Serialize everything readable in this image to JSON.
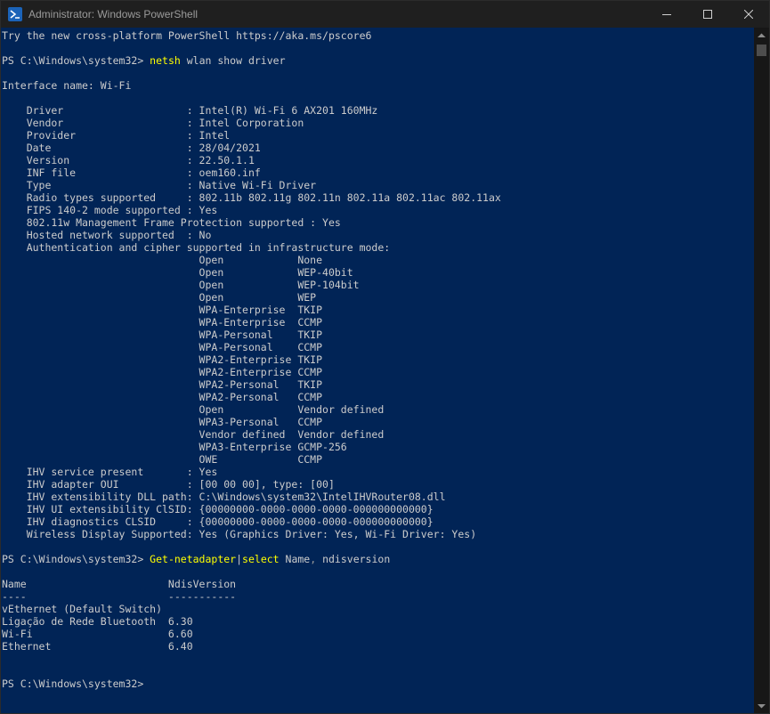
{
  "window": {
    "title": "Administrator: Windows PowerShell"
  },
  "console": {
    "lines": [
      {
        "text": "Try the new cross-platform PowerShell https://aka.ms/pscore6"
      },
      {
        "text": ""
      },
      {
        "prompt": "PS C:\\Windows\\system32> ",
        "cmd": "netsh",
        "rest": " wlan show driver"
      },
      {
        "text": ""
      },
      {
        "text": "Interface name: Wi-Fi"
      },
      {
        "text": ""
      },
      {
        "text": "    Driver                    : Intel(R) Wi-Fi 6 AX201 160MHz"
      },
      {
        "text": "    Vendor                    : Intel Corporation"
      },
      {
        "text": "    Provider                  : Intel"
      },
      {
        "text": "    Date                      : 28/04/2021"
      },
      {
        "text": "    Version                   : 22.50.1.1"
      },
      {
        "text": "    INF file                  : oem160.inf"
      },
      {
        "text": "    Type                      : Native Wi-Fi Driver"
      },
      {
        "text": "    Radio types supported     : 802.11b 802.11g 802.11n 802.11a 802.11ac 802.11ax"
      },
      {
        "text": "    FIPS 140-2 mode supported : Yes"
      },
      {
        "text": "    802.11w Management Frame Protection supported : Yes"
      },
      {
        "text": "    Hosted network supported  : No"
      },
      {
        "text": "    Authentication and cipher supported in infrastructure mode:"
      },
      {
        "text": "                                Open            None"
      },
      {
        "text": "                                Open            WEP-40bit"
      },
      {
        "text": "                                Open            WEP-104bit"
      },
      {
        "text": "                                Open            WEP"
      },
      {
        "text": "                                WPA-Enterprise  TKIP"
      },
      {
        "text": "                                WPA-Enterprise  CCMP"
      },
      {
        "text": "                                WPA-Personal    TKIP"
      },
      {
        "text": "                                WPA-Personal    CCMP"
      },
      {
        "text": "                                WPA2-Enterprise TKIP"
      },
      {
        "text": "                                WPA2-Enterprise CCMP"
      },
      {
        "text": "                                WPA2-Personal   TKIP"
      },
      {
        "text": "                                WPA2-Personal   CCMP"
      },
      {
        "text": "                                Open            Vendor defined"
      },
      {
        "text": "                                WPA3-Personal   CCMP"
      },
      {
        "text": "                                Vendor defined  Vendor defined"
      },
      {
        "text": "                                WPA3-Enterprise GCMP-256"
      },
      {
        "text": "                                OWE             CCMP"
      },
      {
        "text": "    IHV service present       : Yes"
      },
      {
        "text": "    IHV adapter OUI           : [00 00 00], type: [00]"
      },
      {
        "text": "    IHV extensibility DLL path: C:\\Windows\\system32\\IntelIHVRouter08.dll"
      },
      {
        "text": "    IHV UI extensibility ClSID: {00000000-0000-0000-0000-000000000000}"
      },
      {
        "text": "    IHV diagnostics CLSID     : {00000000-0000-0000-0000-000000000000}"
      },
      {
        "text": "    Wireless Display Supported: Yes (Graphics Driver: Yes, Wi-Fi Driver: Yes)"
      },
      {
        "text": ""
      },
      {
        "prompt": "PS C:\\Windows\\system32> ",
        "cmd": "Get-netadapter",
        "rest": "|",
        "cmd2": "select",
        "rest2": " Name",
        "param": ",",
        "rest3": " ndisversion"
      },
      {
        "text": ""
      },
      {
        "text": "Name                       NdisVersion"
      },
      {
        "text": "----                       -----------"
      },
      {
        "text": "vEthernet (Default Switch)"
      },
      {
        "text": "Ligação de Rede Bluetooth  6.30"
      },
      {
        "text": "Wi-Fi                      6.60"
      },
      {
        "text": "Ethernet                   6.40"
      },
      {
        "text": ""
      },
      {
        "text": ""
      },
      {
        "text": "PS C:\\Windows\\system32>"
      }
    ]
  }
}
